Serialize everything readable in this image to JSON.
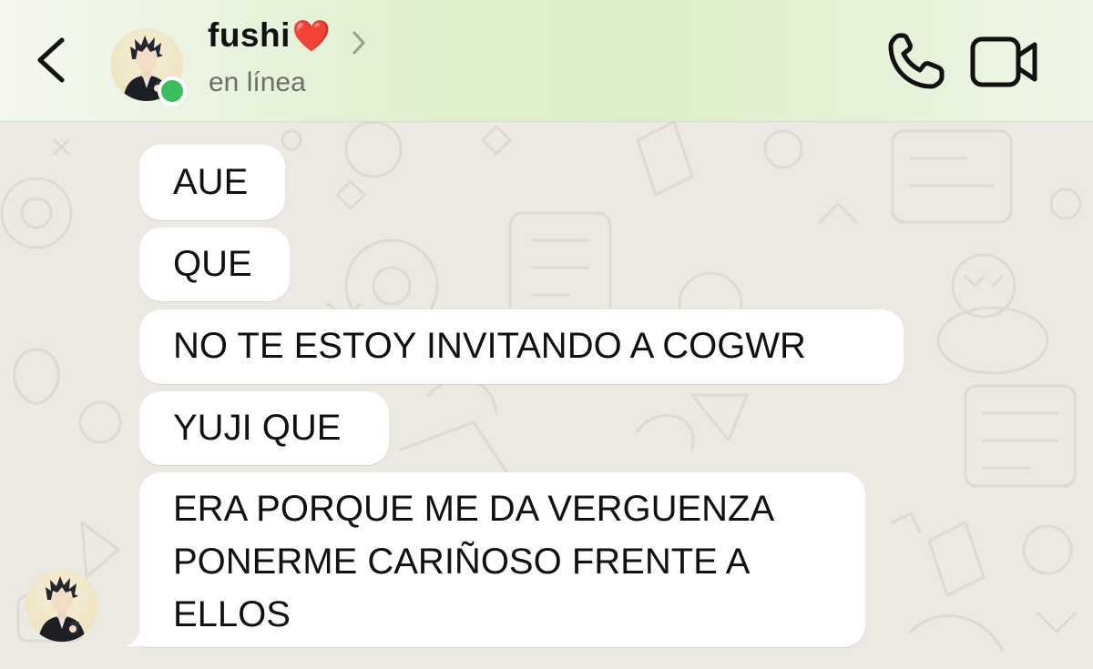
{
  "header": {
    "contact_name": "fushi",
    "name_emoji": "❤️",
    "status": "en línea",
    "icons": {
      "back": "chevron-left-icon",
      "info": "chevron-right-icon",
      "call": "phone-icon",
      "video": "video-camera-icon"
    }
  },
  "colors": {
    "online": "#3bbf5a",
    "bubble": "#ffffff",
    "chat_background": "#ece9e2",
    "header_tint": "#dcefca"
  },
  "messages": [
    {
      "lines": [
        "AUE"
      ]
    },
    {
      "lines": [
        "QUE"
      ]
    },
    {
      "lines": [
        "NO TE ESTOY INVITANDO A COGWR"
      ]
    },
    {
      "lines": [
        "YUJI QUE"
      ]
    },
    {
      "lines": [
        "ERA PORQUE ME DA VERGUENZA",
        "PONERME CARIÑOSO FRENTE A",
        "ELLOS"
      ]
    }
  ]
}
